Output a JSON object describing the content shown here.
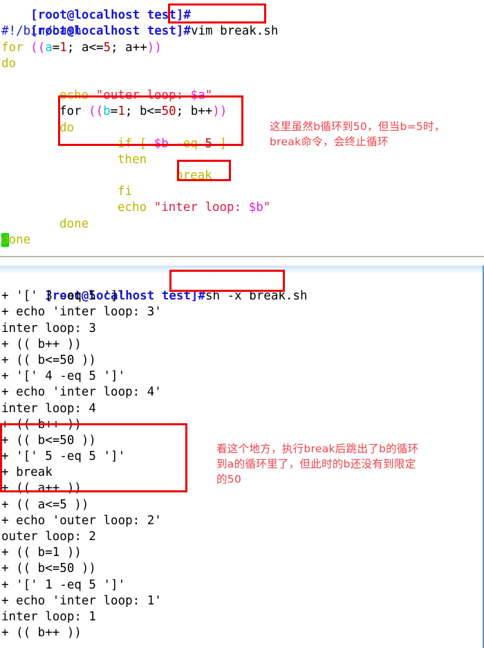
{
  "vim_session": {
    "cut_top_line": "[root@localhost test]#",
    "prompt": "[root@localhost test]#",
    "command": "vim break.sh",
    "script_lines": [
      {
        "indent": 0,
        "tokens": [
          {
            "t": "#!/bin/bash",
            "c": "comment"
          }
        ]
      },
      {
        "indent": 0,
        "tokens": [
          {
            "t": "for ",
            "c": "keyword"
          },
          {
            "t": "((",
            "c": "paren"
          },
          {
            "t": "a",
            "c": "var"
          },
          {
            "t": "=",
            "c": "plain"
          },
          {
            "t": "1",
            "c": "num"
          },
          {
            "t": "; a<=",
            "c": "plain"
          },
          {
            "t": "5",
            "c": "num"
          },
          {
            "t": "; a++",
            "c": "plain"
          },
          {
            "t": "))",
            "c": "paren"
          }
        ]
      },
      {
        "indent": 0,
        "tokens": [
          {
            "t": "do",
            "c": "keyword"
          }
        ]
      },
      {
        "indent": 0,
        "tokens": [
          {
            "t": "",
            "c": "plain"
          }
        ]
      },
      {
        "indent": 8,
        "tokens": [
          {
            "t": "echo ",
            "c": "keyword"
          },
          {
            "t": "\"outer loop: ",
            "c": "string"
          },
          {
            "t": "$a",
            "c": "dollar"
          },
          {
            "t": "\"",
            "c": "string"
          }
        ]
      },
      {
        "indent": 8,
        "tokens": [
          {
            "t": "for ",
            "c": "plain"
          },
          {
            "t": "((",
            "c": "paren"
          },
          {
            "t": "b",
            "c": "var"
          },
          {
            "t": "=",
            "c": "plain"
          },
          {
            "t": "1",
            "c": "num"
          },
          {
            "t": "; b<=",
            "c": "plain"
          },
          {
            "t": "50",
            "c": "num"
          },
          {
            "t": "; b++",
            "c": "plain"
          },
          {
            "t": "))",
            "c": "paren"
          }
        ]
      },
      {
        "indent": 8,
        "tokens": [
          {
            "t": "do",
            "c": "keyword"
          }
        ]
      },
      {
        "indent": 16,
        "tokens": [
          {
            "t": "if [ ",
            "c": "keyword"
          },
          {
            "t": "$b",
            "c": "dollar"
          },
          {
            "t": " -eq ",
            "c": "keyword"
          },
          {
            "t": "5",
            "c": "num"
          },
          {
            "t": " ]",
            "c": "keyword"
          }
        ]
      },
      {
        "indent": 16,
        "tokens": [
          {
            "t": "then",
            "c": "keyword"
          }
        ]
      },
      {
        "indent": 24,
        "tokens": [
          {
            "t": "break",
            "c": "keyword"
          }
        ]
      },
      {
        "indent": 16,
        "tokens": [
          {
            "t": "fi",
            "c": "keyword"
          }
        ]
      },
      {
        "indent": 16,
        "tokens": [
          {
            "t": "echo ",
            "c": "keyword"
          },
          {
            "t": "\"inter loop: ",
            "c": "string"
          },
          {
            "t": "$b",
            "c": "dollar"
          },
          {
            "t": "\"",
            "c": "string"
          }
        ]
      },
      {
        "indent": 8,
        "tokens": [
          {
            "t": "done",
            "c": "keyword"
          }
        ]
      },
      {
        "indent": 0,
        "tokens": [
          {
            "t": "d",
            "c": "cursor"
          },
          {
            "t": "one",
            "c": "keyword"
          }
        ]
      }
    ]
  },
  "trace_session": {
    "prompt": "[root@localhost test]#",
    "command": "sh -x break.sh",
    "output_lines": [
      "+ '[' 3 -eq 5 ']'",
      "+ echo 'inter loop: 3'",
      "inter loop: 3",
      "+ (( b++ ))",
      "+ (( b<=50 ))",
      "+ '[' 4 -eq 5 ']'",
      "+ echo 'inter loop: 4'",
      "inter loop: 4",
      "+ (( b++ ))",
      "+ (( b<=50 ))",
      "+ '[' 5 -eq 5 ']'",
      "+ break",
      "+ (( a++ ))",
      "+ (( a<=5 ))",
      "+ echo 'outer loop: 2'",
      "outer loop: 2",
      "+ (( b=1 ))",
      "+ (( b<=50 ))",
      "+ '[' 1 -eq 5 ']'",
      "+ echo 'inter loop: 1'",
      "inter loop: 1",
      "+ (( b++ ))"
    ]
  },
  "annotations": {
    "note_one": "这里虽然b循环到50，但当b=5时，\nbreak命令，会终止循环",
    "note_two": "看这个地方，执行break后跳出了b的循环\n到a的循环里了，但此时的b还没有到限定\n的50"
  },
  "colors": {
    "box_red": "#f00000",
    "note_red": "#f0404a",
    "prompt_blue": "#1717d4",
    "keyword_olive": "#b8b800",
    "string_crimson": "#e02040",
    "variable_magenta": "#e020e0",
    "number_darkred": "#c00000",
    "cursor_green": "#00e000"
  }
}
